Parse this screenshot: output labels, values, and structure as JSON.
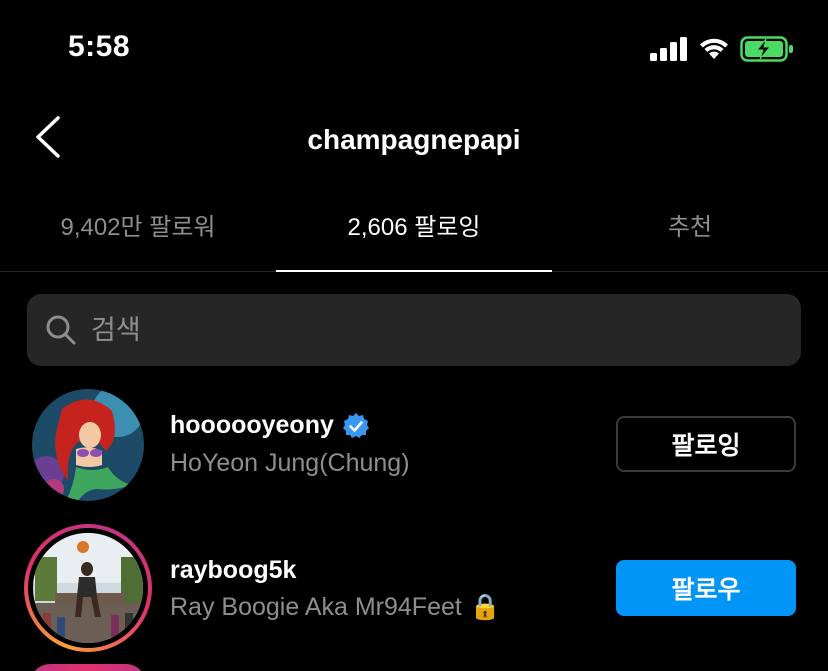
{
  "status_bar": {
    "time": "5:58",
    "battery_color": "#4cd964"
  },
  "header": {
    "back_icon": "chevron-left-icon",
    "title": "champagnepapi"
  },
  "tabs": [
    {
      "label": "9,402만 팔로워",
      "active": false
    },
    {
      "label": "2,606 팔로잉",
      "active": true
    },
    {
      "label": "추천",
      "active": false
    }
  ],
  "search": {
    "placeholder": "검색",
    "value": ""
  },
  "users": [
    {
      "username": "hoooooyeony",
      "full_name": "HoYeon Jung(Chung)",
      "verified": true,
      "has_story": false,
      "button_label": "팔로잉",
      "button_style": "following"
    },
    {
      "username": "rayboog5k",
      "full_name": "Ray Boogie Aka Mr94Feet",
      "full_name_emoji": "🔒",
      "verified": false,
      "has_story": true,
      "button_label": "팔로우",
      "button_style": "follow"
    }
  ],
  "colors": {
    "accent_blue": "#0095f6",
    "secondary_text": "#8e8e8e",
    "search_bg": "#262626"
  }
}
